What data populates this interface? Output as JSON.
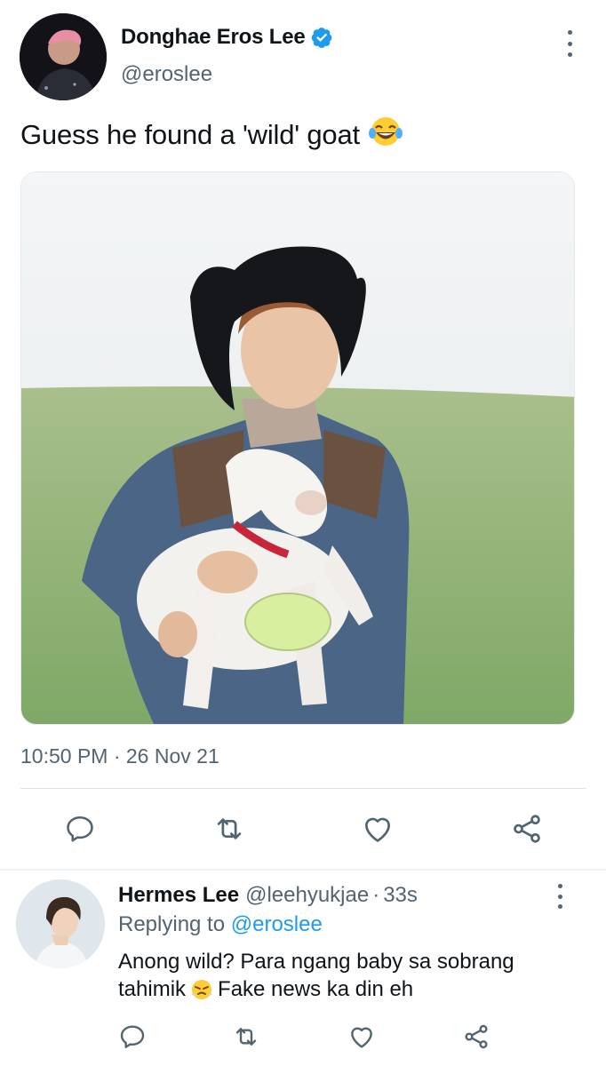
{
  "tweet": {
    "author_name": "Donghae Eros Lee",
    "author_handle": "@eroslee",
    "text": "Guess he found a 'wild' goat",
    "emoji": "laughing-tears-emoji",
    "timestamp": "10:50 PM · 26 Nov 21",
    "verified": true
  },
  "reply": {
    "author_name": "Hermes Lee",
    "author_handle": "@leehyukjae",
    "separator": "·",
    "time": "33s",
    "replying_prefix": "Replying to",
    "replying_to": "@eroslee",
    "text_part1": "Anong wild? Para ngang baby sa sobrang tahimik",
    "emoji": "steam-nose-emoji",
    "text_part2": "Fake news ka din eh"
  },
  "icons": {
    "more": "more-vertical-icon",
    "reply": "reply-icon",
    "retweet": "retweet-icon",
    "like": "heart-icon",
    "share": "share-icon"
  },
  "colors": {
    "text_primary": "#0f1419",
    "text_secondary": "#536471",
    "accent": "#1d9bf0",
    "verified": "#1d9bf0",
    "divider": "#dde3e7"
  }
}
